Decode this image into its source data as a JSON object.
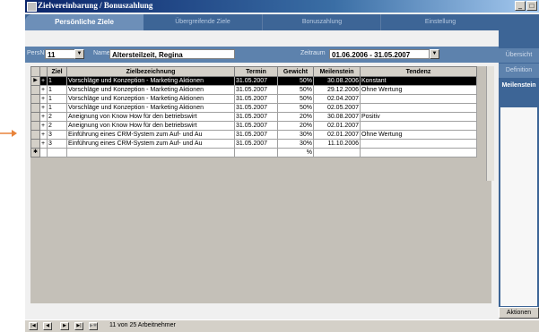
{
  "window": {
    "title": "Zielvereinbarung / Bonuszahlung"
  },
  "colors": {
    "arrow": "#e8833a",
    "title_bar": "#0a246a",
    "tab_bar": "#3d6596",
    "filter_bar": "#5d82ad",
    "selected_row": "#000000"
  },
  "tabs": [
    {
      "label": "Persönliche Ziele",
      "active": true
    },
    {
      "label": "Übergreifende Ziele",
      "active": false
    },
    {
      "label": "Bonuszahlung",
      "active": false
    },
    {
      "label": "Einstellung",
      "active": false
    }
  ],
  "filter": {
    "persnr_label": "PersNr",
    "persnr_value": "11",
    "name_label": "Name",
    "name_value": "Altersteilzeit, Regina",
    "zeitraum_label": "Zeitraum",
    "zeitraum_value": "01.06.2006 - 31.05.2007"
  },
  "grid": {
    "columns": [
      "Ziel",
      "Zielbezeichnung",
      "Termin",
      "Gewicht",
      "Meilenstein",
      "Tendenz"
    ],
    "rows": [
      {
        "expand": "+",
        "ziel": "1",
        "bezeichnung": "Vorschläge und Konzeption - Marketing Aktionen",
        "termin": "31.05.2007",
        "gewicht": "50%",
        "meilenstein": "30.08.2006",
        "tendenz": "Konstant"
      },
      {
        "expand": "+",
        "ziel": "1",
        "bezeichnung": "Vorschläge und Konzeption - Marketing Aktionen",
        "termin": "31.05.2007",
        "gewicht": "50%",
        "meilenstein": "29.12.2006",
        "tendenz": "Ohne Wertung"
      },
      {
        "expand": "+",
        "ziel": "1",
        "bezeichnung": "Vorschläge und Konzeption - Marketing Aktionen",
        "termin": "31.05.2007",
        "gewicht": "50%",
        "meilenstein": "02.04.2007",
        "tendenz": ""
      },
      {
        "expand": "+",
        "ziel": "1",
        "bezeichnung": "Vorschläge und Konzeption - Marketing Aktionen",
        "termin": "31.05.2007",
        "gewicht": "50%",
        "meilenstein": "02.05.2007",
        "tendenz": ""
      },
      {
        "expand": "+",
        "ziel": "2",
        "bezeichnung": "Aneignung von Know How für den betriebswirt",
        "termin": "31.05.2007",
        "gewicht": "20%",
        "meilenstein": "30.08.2007",
        "tendenz": "Positiv"
      },
      {
        "expand": "+",
        "ziel": "2",
        "bezeichnung": "Aneignung von Know How für den betriebswirt",
        "termin": "31.05.2007",
        "gewicht": "20%",
        "meilenstein": "02.01.2007",
        "tendenz": ""
      },
      {
        "expand": "+",
        "ziel": "3",
        "bezeichnung": "Einführung eines CRM-System zum Auf- und Au",
        "termin": "31.05.2007",
        "gewicht": "30%",
        "meilenstein": "02.01.2007",
        "tendenz": "Ohne Wertung"
      },
      {
        "expand": "+",
        "ziel": "3",
        "bezeichnung": "Einführung eines CRM-System zum Auf- und Au",
        "termin": "31.05.2007",
        "gewicht": "30%",
        "meilenstein": "11.10.2006",
        "tendenz": ""
      },
      {
        "expand": "",
        "ziel": "",
        "bezeichnung": "",
        "termin": "",
        "gewicht": "%",
        "meilenstein": "",
        "tendenz": ""
      }
    ]
  },
  "right_panel": {
    "tabs": [
      "Übersicht",
      "Definition",
      "Meilenstein"
    ],
    "active": "Meilenstein",
    "action_button": "Aktionen"
  },
  "navigation": {
    "record_text": "11 von 25 Arbeitnehmer"
  }
}
